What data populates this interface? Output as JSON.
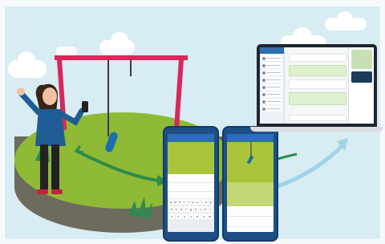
{
  "scene": {
    "colors": {
      "sky": "#d8ecf3",
      "grass": "#8fba35",
      "swing_frame": "#d8285b",
      "phone_blue": "#1d4f86",
      "accent_green": "#a9c63a",
      "arrow": "#2e8b4a",
      "arrow_cyan": "#9fd3e6"
    },
    "icons": [
      "cloud-icon",
      "swing-icon",
      "person-icon",
      "arrow-icon",
      "phone-icon",
      "laptop-icon"
    ]
  },
  "phone_left": {
    "keyboard_rows": [
      [
        "q",
        "w",
        "e",
        "r",
        "t",
        "y",
        "u",
        "i",
        "o",
        "p"
      ],
      [
        "a",
        "s",
        "d",
        "f",
        "g",
        "h",
        "j",
        "k",
        "l"
      ],
      [
        "z",
        "x",
        "c",
        "v",
        "b",
        "n",
        "m"
      ]
    ]
  }
}
